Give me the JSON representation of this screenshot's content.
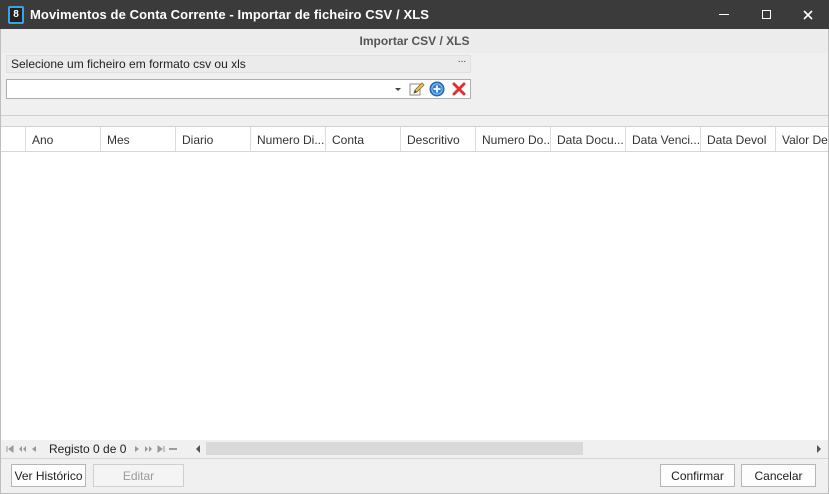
{
  "window": {
    "title": "Movimentos de Conta Corrente - Importar de ficheiro CSV / XLS",
    "icon_glyph": "8",
    "icon": "app-logo-icon"
  },
  "panel": {
    "title": "Importar CSV / XLS",
    "file_label": "Selecione um ficheiro em formato csv ou xls",
    "ellipsis": "···",
    "file_value": ""
  },
  "grid": {
    "columns": [
      "Ano",
      "Mes",
      "Diario",
      "Numero Di...",
      "Conta",
      "Descritivo",
      "Numero Do...",
      "Data Docu...",
      "Data Venci...",
      "Data Devol",
      "Valor Deb"
    ],
    "rows": []
  },
  "navigator": {
    "record_text": "Registo 0 de 0"
  },
  "footer": {
    "history_label": "Ver Histórico",
    "edit_label": "Editar",
    "confirm_label": "Confirmar",
    "cancel_label": "Cancelar"
  },
  "colors": {
    "titlebar": "#3b3b3b",
    "accent": "#3aa3e3",
    "delete": "#e03030",
    "add": "#2f7fd4"
  }
}
